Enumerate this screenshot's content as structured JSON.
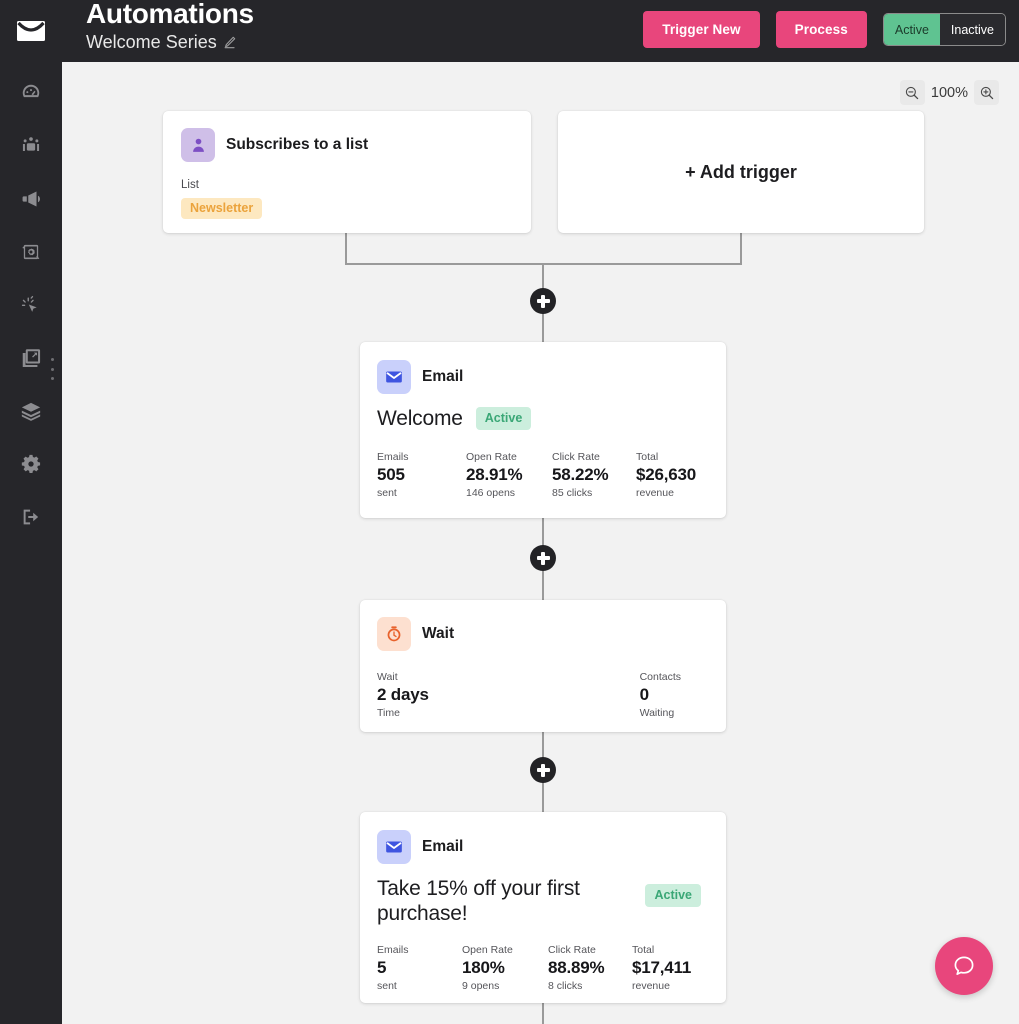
{
  "header": {
    "logo_icon": "envelope-logo-icon",
    "title": "Automations",
    "subtitle": "Welcome Series",
    "edit_icon": "pencil-icon",
    "buttons": {
      "trigger_new": "Trigger New",
      "process": "Process"
    },
    "status_toggle": {
      "active_label": "Active",
      "inactive_label": "Inactive",
      "selected": "Active",
      "active_bg": "#5fc391",
      "inactive_bg": "#2a2a2e"
    },
    "accent_pink": "#e8467c",
    "bar_bg": "#26262a"
  },
  "sidebar": {
    "bg": "#26262a",
    "items": [
      {
        "icon": "dashboard-gauge-icon",
        "name": "sidebar-item-dashboard"
      },
      {
        "icon": "contacts-people-icon",
        "name": "sidebar-item-contacts"
      },
      {
        "icon": "megaphone-campaigns-icon",
        "name": "sidebar-item-campaigns"
      },
      {
        "icon": "automation-gear-refresh-icon",
        "name": "sidebar-item-automations"
      },
      {
        "icon": "magic-wand-sparkle-icon",
        "name": "sidebar-item-magic"
      },
      {
        "icon": "image-gallery-icon",
        "name": "sidebar-item-media"
      },
      {
        "icon": "layers-box-icon",
        "name": "sidebar-item-integrations"
      },
      {
        "icon": "settings-gear-icon",
        "name": "sidebar-item-settings"
      },
      {
        "icon": "logout-arrow-icon",
        "name": "sidebar-item-logout"
      }
    ],
    "drag_handle_icon": "vertical-dots-handle-icon"
  },
  "canvas": {
    "bg": "#f2f2f2",
    "zoom": {
      "out_icon": "zoom-out-icon",
      "level": "100%",
      "in_icon": "zoom-in-icon"
    },
    "add_node_icon": "plus-node-icon",
    "trigger_card": {
      "icon": "subscriber-person-icon",
      "type": "Subscribes to a list",
      "field_label": "List",
      "tag": "Newsletter",
      "tag_bg": "#fde8c0",
      "tag_color": "#eba33c"
    },
    "add_trigger_card": {
      "label": "+ Add trigger"
    },
    "steps": [
      {
        "icon": "email-envelope-icon",
        "type": "Email",
        "subject": "Welcome",
        "status": "Active",
        "stats": [
          {
            "top": "Emails",
            "mid": "505",
            "bot": "sent"
          },
          {
            "top": "Open Rate",
            "mid": "28.91%",
            "bot": "146 opens"
          },
          {
            "top": "Click Rate",
            "mid": "58.22%",
            "bot": "85 clicks"
          },
          {
            "top": "Total",
            "mid": "$26,630",
            "bot": "revenue"
          }
        ]
      },
      {
        "icon": "stopwatch-icon",
        "type": "Wait",
        "stats": [
          {
            "top": "Wait",
            "mid": "2 days",
            "bot": "Time"
          },
          {
            "top": "Contacts",
            "mid": "0",
            "bot": "Waiting"
          }
        ]
      },
      {
        "icon": "email-envelope-icon",
        "type": "Email",
        "subject": "Take 15% off your first purchase!",
        "status": "Active",
        "stats": [
          {
            "top": "Emails",
            "mid": "5",
            "bot": "sent"
          },
          {
            "top": "Open Rate",
            "mid": "180%",
            "bot": "9 opens"
          },
          {
            "top": "Click Rate",
            "mid": "88.89%",
            "bot": "8 clicks"
          },
          {
            "top": "Total",
            "mid": "$17,411",
            "bot": "revenue"
          }
        ]
      }
    ],
    "help_button": {
      "icon": "chat-bubble-help-icon",
      "color": "#e8467c"
    }
  }
}
